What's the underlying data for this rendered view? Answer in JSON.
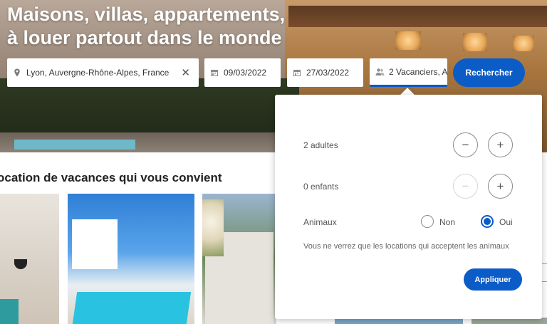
{
  "hero": {
    "title_line1": "Maisons, villas, appartements,",
    "title_line2": "à louer partout dans le monde"
  },
  "search": {
    "location": "Lyon, Auvergne-Rhône-Alpes, France",
    "checkin": "09/03/2022",
    "checkout": "27/03/2022",
    "guests": "2 Vacanciers, A",
    "search_label": "Recherche",
    "search_label_end": "r",
    "clear_icon": "close-icon",
    "location_icon": "map-pin-icon",
    "calendar_icon": "calendar-icon",
    "guests_icon": "people-icon"
  },
  "section": {
    "title": "ocation de vacances qui vous convient"
  },
  "popover": {
    "adults_label": "2 adultes",
    "children_label": "0 enfants",
    "pets_label": "Animaux",
    "no_label": "Non",
    "yes_label": "Oui",
    "pets_selected": "Oui",
    "note": "Vous ne verrez que les locations qui acceptent les animaux",
    "apply_label": "Appliquer",
    "minus": "−",
    "plus": "+"
  },
  "colors": {
    "accent": "#0b5cc7",
    "text": "#555555"
  }
}
